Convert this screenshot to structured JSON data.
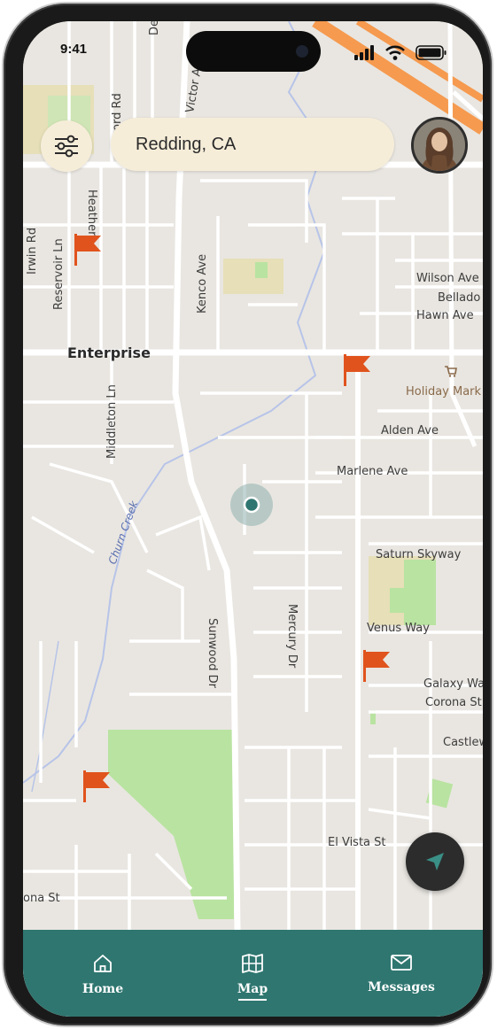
{
  "status_bar": {
    "time": "9:41"
  },
  "search": {
    "location": "Redding, CA"
  },
  "map": {
    "place_labels": {
      "enterprise": "Enterprise",
      "irwin_rd": "Irwin Rd",
      "reservoir_ln": "Reservoir Ln",
      "heather": "Heather",
      "kenco_ave": "Kenco Ave",
      "victor_ave": "Victor Ave",
      "ford_rd": "ord Rd",
      "de": "De",
      "wilson_ave": "Wilson Ave",
      "bellado": "Bellado",
      "hawn_ave": "Hawn Ave",
      "holiday_market": "Holiday Mark",
      "middleton_ln": "Middleton Ln",
      "alden_ave": "Alden Ave",
      "marlene_ave": "Marlene Ave",
      "churn_creek": "Churn Creek",
      "saturn_skyway": "Saturn Skyway",
      "venus_way": "Venus Way",
      "sunwood_dr": "Sunwood Dr",
      "mercury_dr": "Mercury Dr",
      "galaxy_way": "Galaxy Way",
      "corona_st": "Corona St",
      "castlew": "Castlew",
      "el_vista_st": "El Vista St",
      "ona_st": "ona St"
    },
    "flag_color": "#e0531d",
    "park_color": "#b9e3a1",
    "road_color": "#ffffff",
    "highway_color": "#f59a4f",
    "icons": {
      "filter": "sliders-icon",
      "locate": "navigation-arrow-icon",
      "flag": "flag-icon",
      "shop": "shopping-cart-icon"
    }
  },
  "nav": {
    "home_label": "Home",
    "map_label": "Map",
    "messages_label": "Messages",
    "active": "Map",
    "accent": "#2f7670"
  }
}
